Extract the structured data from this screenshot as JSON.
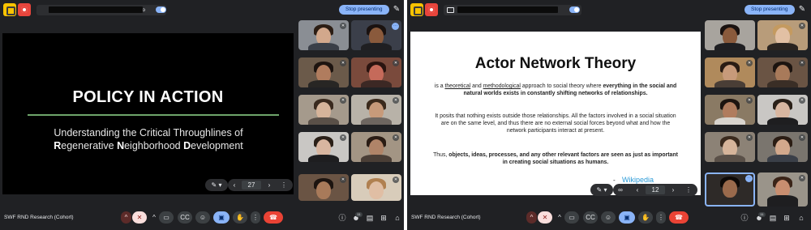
{
  "left": {
    "share_url": "",
    "share_tail": "o",
    "stop_presenting": "Stop presenting",
    "slide": {
      "title": "POLICY IN ACTION",
      "subtitle_line1": "Understanding the Critical Throughlines of",
      "subtitle_line2_r": "R",
      "subtitle_line2_a": "egenerative ",
      "subtitle_line2_n": "N",
      "subtitle_line2_b": "eighborhood ",
      "subtitle_line2_d": "D",
      "subtitle_line2_c": "evelopment"
    },
    "page_number": "27",
    "meeting_name": "SWF RND Research (Cohort)",
    "participant_count": "11"
  },
  "right": {
    "share_tail": "o",
    "stop_presenting": "Stop presenting",
    "slide": {
      "title": "Actor Network Theory",
      "p1_a": "is a ",
      "p1_b": "theoretical",
      "p1_c": " and ",
      "p1_d": "methodological",
      "p1_e": " approach to social theory where",
      "p1_bold": "everything in the social and natural worlds exists in constantly shifting networks of relationships.",
      "p2": "It posits that nothing exists outside those relationships. All the factors involved in a social situation are on the same level, and thus there are no external social forces beyond what and how the network participants interact at present.",
      "p3_a": "Thus, ",
      "p3_bold": "objects, ideas, processes, and any other relevant factors are seen as just as important in creating social situations as humans.",
      "dash": "-",
      "wiki": "Wikipedia"
    },
    "page_number": "12",
    "meeting_name": "SWF RND Research (Cohort)",
    "participant_count": "11"
  },
  "icons": {
    "pin": "pin-icon",
    "prev": "chevron-left-icon",
    "next": "chevron-right-icon",
    "more": "more-vert-icon",
    "mic_off": "mic-off-icon",
    "camera": "camera-icon",
    "captions": "captions-icon",
    "emoji": "emoji-icon",
    "present": "present-icon",
    "hand": "raise-hand-icon",
    "end": "end-call-icon",
    "info": "info-icon",
    "people": "people-icon",
    "chat": "chat-icon",
    "activities": "activities-icon",
    "lock": "host-controls-icon"
  },
  "colors": {
    "background": "#202124",
    "accent": "#8ab4f8",
    "end_call": "#ea4335",
    "mic_off_bg": "#f9dedc",
    "slide_rule": "#6fa56b",
    "wiki_link": "#2a9ad7"
  }
}
